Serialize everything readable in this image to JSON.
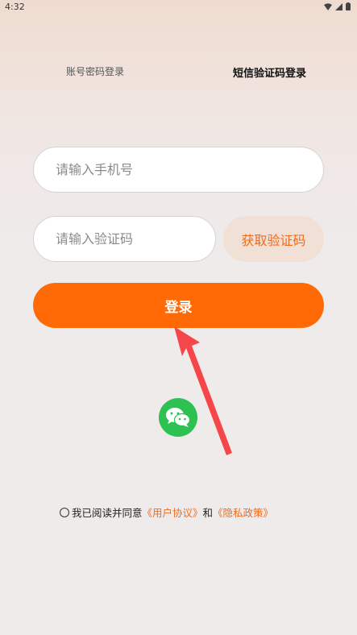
{
  "status": {
    "time": "4:32"
  },
  "tabs": {
    "password_login": "账号密码登录",
    "sms_login": "短信验证码登录"
  },
  "form": {
    "phone_placeholder": "请输入手机号",
    "code_placeholder": "请输入验证码",
    "get_code_label": "获取验证码",
    "login_label": "登录"
  },
  "agreement": {
    "prefix": "我已阅读并同意",
    "user_agreement": "《用户协议》",
    "conjunction": "和",
    "privacy_policy": "《隐私政策》"
  },
  "colors": {
    "accent": "#ff6a06",
    "link": "#f06b1c",
    "wechat": "#2dc152"
  }
}
